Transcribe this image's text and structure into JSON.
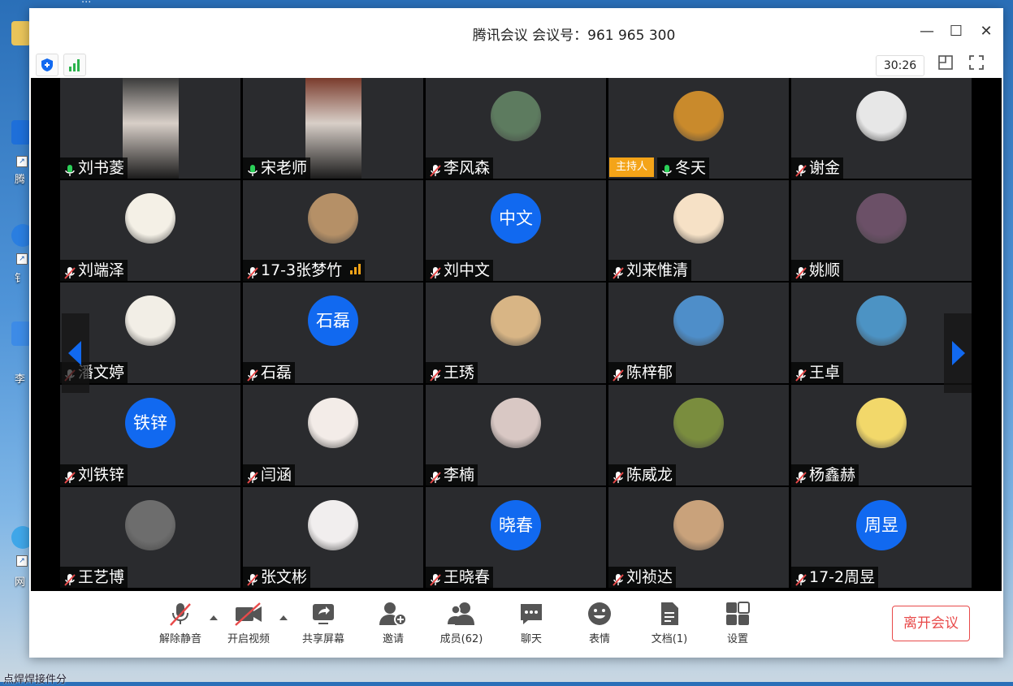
{
  "desktop": {
    "top_text": "...",
    "icons": [
      {
        "label": "腾"
      },
      {
        "label": "钅"
      },
      {
        "label": "李"
      },
      {
        "label": "网"
      }
    ],
    "taskbar_text": "点焊焊接件分"
  },
  "window": {
    "title": "腾讯会议 会议号：961 965 300",
    "timer": "30:26",
    "controls": {
      "minimize": "—",
      "maximize": "☐",
      "close": "✕"
    }
  },
  "participants": [
    {
      "name": "刘书菱",
      "mic": "on",
      "type": "video",
      "color": "#3b3b3b"
    },
    {
      "name": "宋老师",
      "mic": "on",
      "type": "video",
      "color": "#7a3b2c"
    },
    {
      "name": "李风森",
      "mic": "muted",
      "type": "photo",
      "color": "#5d7b5f"
    },
    {
      "name": "冬天",
      "mic": "on",
      "type": "photo",
      "color": "#c98a2c",
      "host": "主持人"
    },
    {
      "name": "谢金",
      "mic": "muted",
      "type": "photo",
      "color": "#e7e7e7"
    },
    {
      "name": "刘端泽",
      "mic": "muted",
      "type": "photo",
      "color": "#f4f0e6"
    },
    {
      "name": "17-3张梦竹",
      "mic": "muted",
      "type": "photo",
      "color": "#b59067",
      "signal": true
    },
    {
      "name": "刘中文",
      "mic": "muted",
      "type": "text",
      "avatar_text": "中文"
    },
    {
      "name": "刘来惟清",
      "mic": "muted",
      "type": "photo",
      "color": "#f6e1c6"
    },
    {
      "name": "姚顺",
      "mic": "muted",
      "type": "photo",
      "color": "#6b5067"
    },
    {
      "name": "潘文婷",
      "mic": "muted",
      "type": "photo",
      "color": "#f2eee6"
    },
    {
      "name": "石磊",
      "mic": "muted",
      "type": "text",
      "avatar_text": "石磊"
    },
    {
      "name": "王琇",
      "mic": "muted",
      "type": "photo",
      "color": "#d8b585"
    },
    {
      "name": "陈梓郁",
      "mic": "muted",
      "type": "photo",
      "color": "#4e8ec9"
    },
    {
      "name": "王卓",
      "mic": "muted",
      "type": "photo",
      "color": "#4c93c4"
    },
    {
      "name": "刘铁锌",
      "mic": "muted",
      "type": "text",
      "avatar_text": "铁锌"
    },
    {
      "name": "闫涵",
      "mic": "muted",
      "type": "photo",
      "color": "#f3ece8"
    },
    {
      "name": "李楠",
      "mic": "muted",
      "type": "photo",
      "color": "#d9c8c4"
    },
    {
      "name": " 陈威龙",
      "mic": "muted",
      "type": "photo",
      "color": "#7a8d3e"
    },
    {
      "name": "杨鑫赫",
      "mic": "muted",
      "type": "photo",
      "color": "#f2d86a"
    },
    {
      "name": "王艺博",
      "mic": "muted",
      "type": "photo",
      "color": "#6d6d6d"
    },
    {
      "name": "张文彬",
      "mic": "muted",
      "type": "photo",
      "color": "#f1eeee"
    },
    {
      "name": "王晓春",
      "mic": "muted",
      "type": "text",
      "avatar_text": "晓春"
    },
    {
      "name": "刘祯达",
      "mic": "muted",
      "type": "photo",
      "color": "#c9a27b"
    },
    {
      "name": "17-2周昱",
      "mic": "muted",
      "type": "text",
      "avatar_text": "周昱"
    }
  ],
  "bottombar": {
    "mute": "解除静音",
    "video": "开启视频",
    "share": "共享屏幕",
    "invite": "邀请",
    "members": "成员(62)",
    "chat": "聊天",
    "emoji": "表情",
    "docs": "文档(1)",
    "settings": "设置",
    "leave": "离开会议"
  },
  "colors": {
    "accent": "#1169f0",
    "tile": "#2a2b2e",
    "leave": "#e84a4a",
    "host": "#f4a418"
  }
}
